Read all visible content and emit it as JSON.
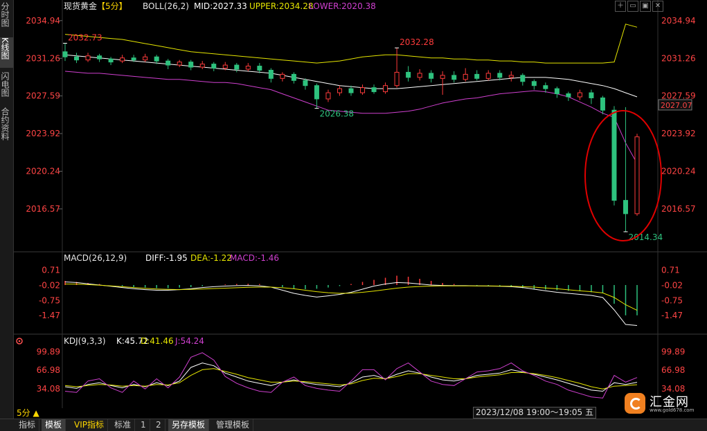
{
  "left_tabs": [
    {
      "label": "分时图",
      "active": false
    },
    {
      "label": "K线图",
      "active": true
    },
    {
      "label": "闪电图",
      "active": false
    },
    {
      "label": "合约资料",
      "active": false
    }
  ],
  "main": {
    "symbol": "现货黄金",
    "period": "【5分】",
    "boll": {
      "label": "BOLL(26,2)",
      "mid": "MID:2027.33",
      "upper": "UPPER:2034.28",
      "lower": "LOWER:2020.38"
    },
    "y_ticks": [
      "2034.94",
      "2031.26",
      "2027.59",
      "2023.92",
      "2020.24",
      "2016.57"
    ],
    "current_price": "2027.07",
    "annotations": {
      "high_left": "2032.73",
      "high_mid": "2032.28",
      "low_mid": "2026.38",
      "low_end": "2014.34"
    },
    "ylim": [
      2014.0,
      2035.6
    ]
  },
  "macd": {
    "label": "MACD(26,12,9)",
    "diff": "DIFF:-1.95",
    "dea": "DEA:-1.22",
    "macd": "MACD:-1.46",
    "y_ticks": [
      "0.71",
      "-0.02",
      "-0.75",
      "-1.47"
    ],
    "ylim": [
      -2.2,
      1.0
    ]
  },
  "kdj": {
    "label": "KDJ(9,3,3)",
    "k": "K:45.72",
    "d": "D:41.46",
    "j": "J:54.24",
    "y_ticks": [
      "99.89",
      "66.98",
      "34.08"
    ],
    "ylim": [
      5,
      110
    ]
  },
  "bottom": {
    "period_label": "5分 ▲",
    "datetime": "2023/12/08 19:00～19:05 五",
    "tabs": [
      {
        "label": "指标",
        "active": false
      },
      {
        "label": "模板",
        "active": true
      },
      {
        "label": "VIP指标",
        "active": false,
        "color": "#ffd800"
      },
      {
        "label": "标准",
        "active": false
      },
      {
        "label": "1",
        "active": false
      },
      {
        "label": "2",
        "active": false
      },
      {
        "label": "另存模板",
        "active": true
      },
      {
        "label": "管理模板",
        "active": false
      }
    ]
  },
  "logo": {
    "name": "汇金网",
    "url": "www.gold678.com"
  },
  "window_buttons": [
    "＋",
    "▭",
    "▣",
    "✕"
  ],
  "colors": {
    "up": "#ff3b3b",
    "down": "#2ec27e",
    "mid": "#ffffff",
    "upper": "#e6e600",
    "lower": "#d040d0",
    "axis": "#ff4444",
    "dea": "#e6e600",
    "diff": "#ffffff",
    "k": "#ffffff",
    "d": "#e6e600",
    "j": "#d040d0",
    "highlight_circle": "#e00000"
  },
  "chart_data": [
    {
      "type": "candlestick",
      "title": "现货黄金【5分】",
      "series": [
        {
          "name": "BOLL MID",
          "values": [
            2031.6,
            2031.5,
            2031.4,
            2031.3,
            2031.2,
            2031.1,
            2031.0,
            2030.9,
            2030.8,
            2030.7,
            2030.6,
            2030.5,
            2030.4,
            2030.3,
            2030.2,
            2030.1,
            2030.0,
            2029.9,
            2029.8,
            2029.6,
            2029.4,
            2029.2,
            2029.0,
            2028.8,
            2028.6,
            2028.5,
            2028.4,
            2028.3,
            2028.3,
            2028.3,
            2028.4,
            2028.5,
            2028.6,
            2028.7,
            2028.8,
            2028.9,
            2029.0,
            2029.1,
            2029.2,
            2029.3,
            2029.4,
            2029.4,
            2029.4,
            2029.3,
            2029.2,
            2029.0,
            2028.8,
            2028.6,
            2028.3,
            2027.9,
            2027.5
          ]
        },
        {
          "name": "BOLL UPPER",
          "values": [
            2033.6,
            2033.5,
            2033.4,
            2033.3,
            2033.2,
            2033.1,
            2032.9,
            2032.7,
            2032.5,
            2032.3,
            2032.1,
            2031.9,
            2031.8,
            2031.7,
            2031.6,
            2031.5,
            2031.4,
            2031.3,
            2031.2,
            2031.1,
            2031.0,
            2030.9,
            2030.8,
            2030.9,
            2031.0,
            2031.2,
            2031.4,
            2031.5,
            2031.6,
            2031.6,
            2031.5,
            2031.4,
            2031.3,
            2031.3,
            2031.2,
            2031.2,
            2031.1,
            2031.1,
            2031.0,
            2031.0,
            2030.9,
            2030.9,
            2030.8,
            2030.8,
            2030.8,
            2030.8,
            2030.8,
            2030.8,
            2030.9,
            2034.6,
            2034.3
          ]
        },
        {
          "name": "BOLL LOWER",
          "values": [
            2030.0,
            2029.9,
            2029.8,
            2029.8,
            2029.7,
            2029.6,
            2029.5,
            2029.4,
            2029.3,
            2029.2,
            2029.2,
            2029.1,
            2029.0,
            2028.9,
            2028.9,
            2028.8,
            2028.6,
            2028.4,
            2028.2,
            2027.8,
            2027.4,
            2027.0,
            2026.6,
            2026.2,
            2026.1,
            2026.0,
            2025.9,
            2025.9,
            2025.9,
            2026.0,
            2026.1,
            2026.3,
            2026.6,
            2026.9,
            2027.1,
            2027.3,
            2027.4,
            2027.6,
            2027.8,
            2027.9,
            2028.0,
            2028.1,
            2028.0,
            2027.8,
            2027.5,
            2027.0,
            2026.5,
            2025.9,
            2025.5,
            2023.0,
            2021.0
          ]
        }
      ],
      "candles": [
        [
          2031.9,
          2031.4,
          2032.73,
          2031.0
        ],
        [
          2031.4,
          2031.1,
          2031.8,
          2030.8
        ],
        [
          2031.1,
          2031.5,
          2031.8,
          2030.9
        ],
        [
          2031.5,
          2031.2,
          2031.7,
          2030.9
        ],
        [
          2031.2,
          2030.9,
          2031.4,
          2030.6
        ],
        [
          2031.0,
          2031.3,
          2031.6,
          2030.8
        ],
        [
          2031.3,
          2031.1,
          2031.6,
          2030.9
        ],
        [
          2031.1,
          2031.4,
          2031.7,
          2030.9
        ],
        [
          2031.4,
          2031.0,
          2031.6,
          2030.7
        ],
        [
          2031.0,
          2030.6,
          2031.2,
          2030.2
        ],
        [
          2030.6,
          2030.9,
          2031.1,
          2030.4
        ],
        [
          2030.9,
          2030.4,
          2031.1,
          2030.1
        ],
        [
          2030.4,
          2030.7,
          2031.0,
          2030.2
        ],
        [
          2030.7,
          2030.3,
          2030.9,
          2030.0
        ],
        [
          2030.3,
          2030.6,
          2030.9,
          2030.1
        ],
        [
          2030.6,
          2030.2,
          2030.8,
          2029.9
        ],
        [
          2030.2,
          2030.5,
          2030.8,
          2030.0
        ],
        [
          2030.5,
          2030.1,
          2030.8,
          2029.8
        ],
        [
          2030.1,
          2029.3,
          2030.3,
          2028.9
        ],
        [
          2029.3,
          2029.7,
          2029.9,
          2029.0
        ],
        [
          2029.7,
          2029.1,
          2029.9,
          2028.8
        ],
        [
          2029.1,
          2028.6,
          2029.3,
          2028.2
        ],
        [
          2028.6,
          2027.3,
          2028.8,
          2026.38
        ],
        [
          2027.3,
          2027.9,
          2028.2,
          2027.0
        ],
        [
          2027.9,
          2028.3,
          2028.6,
          2027.6
        ],
        [
          2028.3,
          2027.9,
          2028.6,
          2027.6
        ],
        [
          2027.9,
          2028.4,
          2028.7,
          2027.7
        ],
        [
          2028.4,
          2028.0,
          2028.7,
          2027.8
        ],
        [
          2028.0,
          2028.6,
          2028.9,
          2027.8
        ],
        [
          2028.6,
          2029.9,
          2032.28,
          2028.4
        ],
        [
          2029.9,
          2029.4,
          2030.5,
          2029.0
        ],
        [
          2029.4,
          2029.8,
          2030.2,
          2029.1
        ],
        [
          2029.8,
          2029.3,
          2030.1,
          2028.9
        ],
        [
          2029.3,
          2029.6,
          2030.0,
          2027.7
        ],
        [
          2029.6,
          2029.2,
          2030.0,
          2028.9
        ],
        [
          2029.2,
          2029.7,
          2030.3,
          2029.0
        ],
        [
          2029.7,
          2029.3,
          2030.1,
          2029.1
        ],
        [
          2029.3,
          2029.8,
          2030.1,
          2029.1
        ],
        [
          2029.8,
          2029.4,
          2030.1,
          2029.1
        ],
        [
          2029.4,
          2029.6,
          2030.0,
          2029.0
        ],
        [
          2029.6,
          2029.0,
          2029.8,
          2028.6
        ],
        [
          2029.0,
          2028.6,
          2029.2,
          2028.2
        ],
        [
          2028.6,
          2028.3,
          2028.9,
          2027.9
        ],
        [
          2028.3,
          2027.8,
          2028.5,
          2027.4
        ],
        [
          2027.8,
          2027.5,
          2028.0,
          2027.1
        ],
        [
          2027.5,
          2027.9,
          2028.2,
          2027.2
        ],
        [
          2027.9,
          2027.4,
          2028.2,
          2026.8
        ],
        [
          2027.4,
          2026.2,
          2027.6,
          2025.8
        ],
        [
          2026.2,
          2017.4,
          2026.6,
          2016.9
        ],
        [
          2017.4,
          2016.1,
          2026.5,
          2014.34
        ],
        [
          2016.1,
          2023.6,
          2023.9,
          2015.9
        ]
      ]
    },
    {
      "type": "bar+line",
      "title": "MACD(26,12,9)",
      "series": [
        {
          "name": "MACD",
          "values": [
            0.2,
            0.15,
            0.1,
            0.05,
            0.0,
            -0.05,
            -0.1,
            -0.12,
            -0.15,
            -0.15,
            -0.12,
            -0.1,
            -0.05,
            0.0,
            0.03,
            0.05,
            0.06,
            0.05,
            0.0,
            -0.1,
            -0.18,
            -0.2,
            -0.18,
            -0.12,
            -0.05,
            0.05,
            0.15,
            0.25,
            0.35,
            0.45,
            0.4,
            0.3,
            0.2,
            0.1,
            0.05,
            0.0,
            -0.03,
            -0.05,
            -0.08,
            -0.1,
            -0.15,
            -0.2,
            -0.22,
            -0.25,
            -0.28,
            -0.3,
            -0.35,
            -0.4,
            -0.9,
            -1.46,
            -1.46
          ]
        },
        {
          "name": "DIFF",
          "values": [
            0.15,
            0.12,
            0.06,
            0.0,
            -0.06,
            -0.12,
            -0.18,
            -0.22,
            -0.25,
            -0.25,
            -0.22,
            -0.18,
            -0.12,
            -0.08,
            -0.05,
            -0.03,
            -0.02,
            -0.04,
            -0.1,
            -0.25,
            -0.4,
            -0.5,
            -0.58,
            -0.52,
            -0.45,
            -0.35,
            -0.2,
            -0.05,
            0.05,
            0.12,
            0.1,
            0.05,
            0.0,
            -0.02,
            -0.03,
            -0.03,
            -0.04,
            -0.05,
            -0.06,
            -0.08,
            -0.12,
            -0.2,
            -0.28,
            -0.35,
            -0.4,
            -0.45,
            -0.5,
            -0.6,
            -1.2,
            -1.9,
            -1.95
          ]
        },
        {
          "name": "DEA",
          "values": [
            0.05,
            0.04,
            0.02,
            -0.01,
            -0.04,
            -0.08,
            -0.12,
            -0.16,
            -0.19,
            -0.21,
            -0.22,
            -0.21,
            -0.19,
            -0.17,
            -0.15,
            -0.13,
            -0.11,
            -0.1,
            -0.1,
            -0.13,
            -0.18,
            -0.25,
            -0.32,
            -0.37,
            -0.4,
            -0.39,
            -0.35,
            -0.29,
            -0.22,
            -0.15,
            -0.1,
            -0.07,
            -0.05,
            -0.04,
            -0.04,
            -0.04,
            -0.04,
            -0.04,
            -0.05,
            -0.06,
            -0.08,
            -0.1,
            -0.14,
            -0.18,
            -0.23,
            -0.28,
            -0.32,
            -0.38,
            -0.6,
            -0.95,
            -1.22
          ]
        }
      ]
    },
    {
      "type": "line",
      "title": "KDJ(9,3,3)",
      "series": [
        {
          "name": "K",
          "values": [
            38,
            35,
            42,
            45,
            40,
            36,
            42,
            38,
            45,
            40,
            48,
            72,
            80,
            75,
            62,
            55,
            48,
            44,
            40,
            46,
            50,
            45,
            42,
            40,
            38,
            45,
            55,
            58,
            52,
            60,
            66,
            62,
            55,
            50,
            48,
            52,
            58,
            60,
            62,
            68,
            64,
            60,
            55,
            50,
            44,
            38,
            32,
            30,
            45,
            42,
            45.72
          ]
        },
        {
          "name": "D",
          "values": [
            40,
            38,
            40,
            42,
            41,
            39,
            40,
            39,
            42,
            41,
            45,
            58,
            68,
            70,
            65,
            60,
            54,
            50,
            46,
            46,
            48,
            47,
            45,
            43,
            41,
            43,
            49,
            53,
            52,
            56,
            61,
            61,
            58,
            55,
            52,
            52,
            55,
            57,
            59,
            63,
            63,
            61,
            58,
            54,
            49,
            44,
            38,
            34,
            39,
            40,
            41.46
          ]
        },
        {
          "name": "J",
          "values": [
            30,
            28,
            48,
            52,
            36,
            28,
            48,
            34,
            52,
            36,
            55,
            90,
            98,
            85,
            56,
            44,
            36,
            30,
            28,
            46,
            55,
            40,
            35,
            32,
            30,
            48,
            68,
            68,
            50,
            70,
            80,
            64,
            48,
            42,
            40,
            52,
            64,
            66,
            70,
            80,
            66,
            58,
            48,
            42,
            32,
            26,
            20,
            18,
            58,
            46,
            54.24
          ]
        }
      ]
    }
  ]
}
